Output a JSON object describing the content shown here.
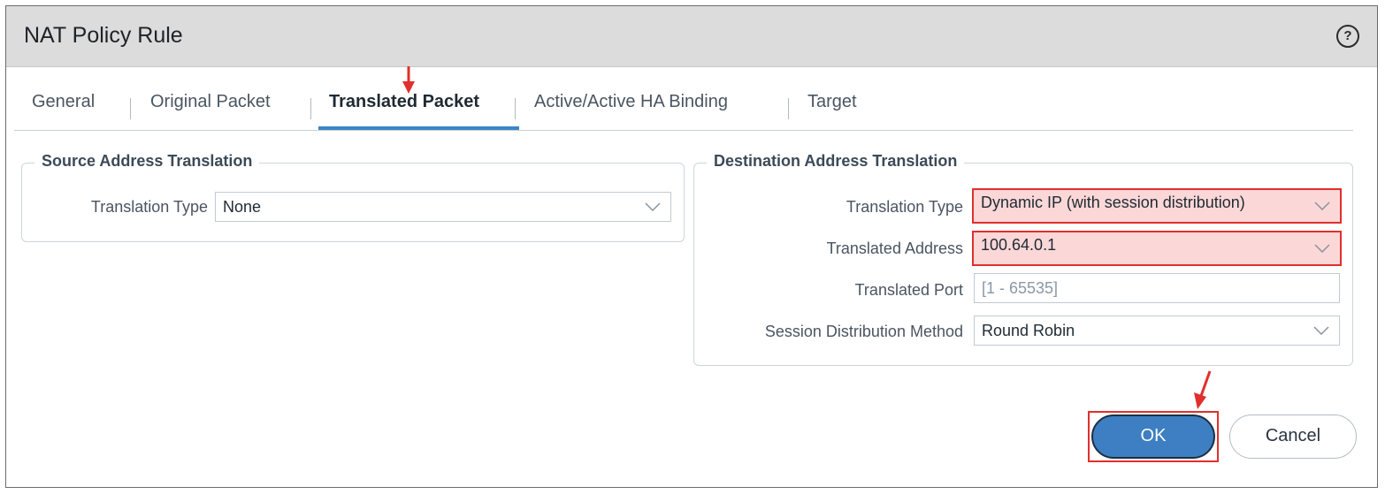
{
  "dialog": {
    "title": "NAT Policy Rule",
    "help_glyph": "?"
  },
  "tabs": [
    {
      "label": "General"
    },
    {
      "label": "Original Packet"
    },
    {
      "label": "Translated Packet",
      "active": true
    },
    {
      "label": "Active/Active HA Binding"
    },
    {
      "label": "Target"
    }
  ],
  "source_translation": {
    "legend": "Source Address Translation",
    "translation_type_label": "Translation Type",
    "translation_type_value": "None"
  },
  "destination_translation": {
    "legend": "Destination Address Translation",
    "translation_type_label": "Translation Type",
    "translation_type_value": "Dynamic IP (with session distribution)",
    "translated_address_label": "Translated Address",
    "translated_address_value": "100.64.0.1",
    "translated_port_label": "Translated Port",
    "translated_port_placeholder": "[1 - 65535]",
    "session_method_label": "Session Distribution Method",
    "session_method_value": "Round Robin"
  },
  "buttons": {
    "ok": "OK",
    "cancel": "Cancel"
  },
  "colors": {
    "accent": "#3d7fc2",
    "highlight_border": "#e0302d",
    "highlight_fill": "#fbd7d7",
    "title_bar": "#dcdcdc"
  },
  "icons": [
    "help-icon",
    "chevron-down-icon",
    "red-arrow-icon"
  ]
}
